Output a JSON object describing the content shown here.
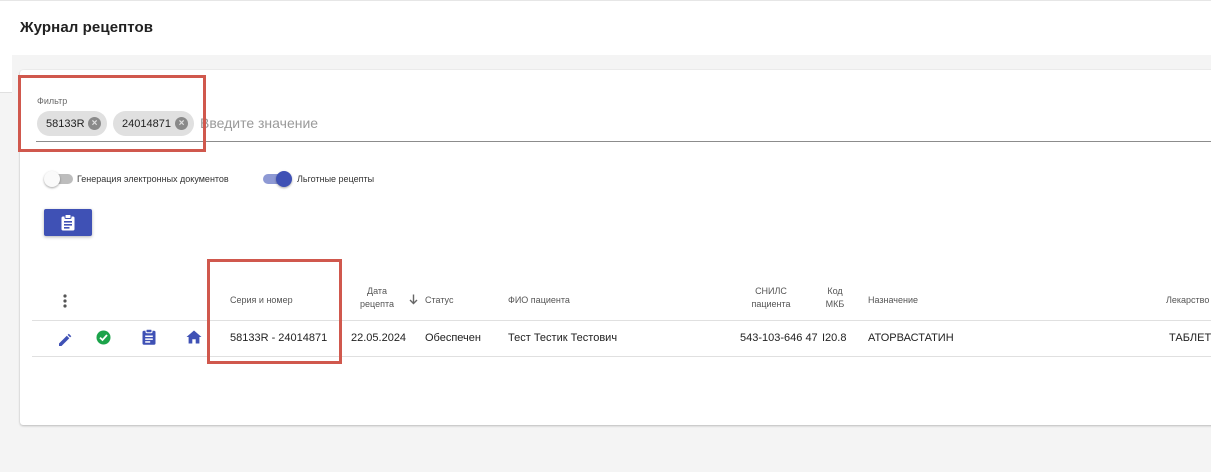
{
  "page": {
    "title": "Журнал рецептов"
  },
  "filter": {
    "label": "Фильтр",
    "placeholder": "Введите значение",
    "chips": [
      {
        "label": "58133R"
      },
      {
        "label": "24014871"
      }
    ]
  },
  "toggles": [
    {
      "label": "Генерация электронных документов",
      "on": false
    },
    {
      "label": "Льготные рецепты",
      "on": true
    }
  ],
  "colors": {
    "primary": "#3f51b5",
    "success": "#1ba34a",
    "highlight": "#d0584d"
  },
  "table": {
    "columns": {
      "series": "Серия и номер",
      "date_line1": "Дата",
      "date_line2": "рецепта",
      "status": "Статус",
      "patient": "ФИО пациента",
      "snils_line1": "СНИЛС",
      "snils_line2": "пациента",
      "mkb_line1": "Код",
      "mkb_line2": "МКБ",
      "purpose": "Назначение",
      "drug": "Лекарство"
    },
    "rows": [
      {
        "series": "58133R - 24014871",
        "date": "22.05.2024",
        "status": "Обеспечен",
        "patient": "Тест Тестик Тестович",
        "snils": "543-103-646 47",
        "mkb": "I20.8",
        "purpose": "АТОРВАСТАТИН",
        "drug": "ТАБЛЕТКИ"
      }
    ]
  }
}
